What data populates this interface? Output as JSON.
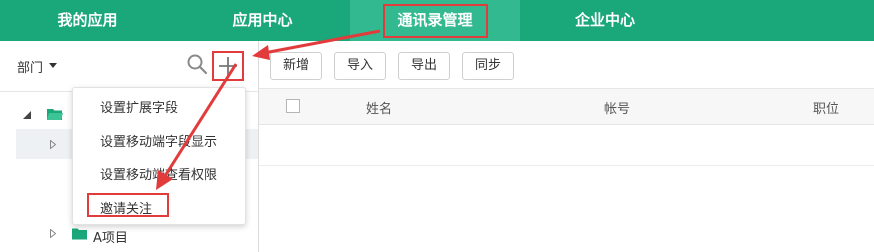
{
  "nav": {
    "tabs": [
      {
        "label": "我的应用",
        "active": false
      },
      {
        "label": "应用中心",
        "active": false
      },
      {
        "label": "通讯录管理",
        "active": true
      },
      {
        "label": "企业中心",
        "active": false
      }
    ]
  },
  "left": {
    "dept_label": "部门",
    "dropdown_items": [
      "设置扩展字段",
      "设置移动端字段显示",
      "设置移动端查看权限",
      "邀请关注"
    ],
    "tree_project_label": "A项目"
  },
  "toolbar": {
    "buttons": [
      "新增",
      "导入",
      "导出",
      "同步"
    ]
  },
  "table": {
    "headers": [
      "姓名",
      "帐号",
      "职位"
    ]
  },
  "colors": {
    "nav_bg": "#1aa77a",
    "nav_active": "#33b990",
    "annotation_red": "#e23b3b",
    "folder_green": "#1aa77a"
  }
}
